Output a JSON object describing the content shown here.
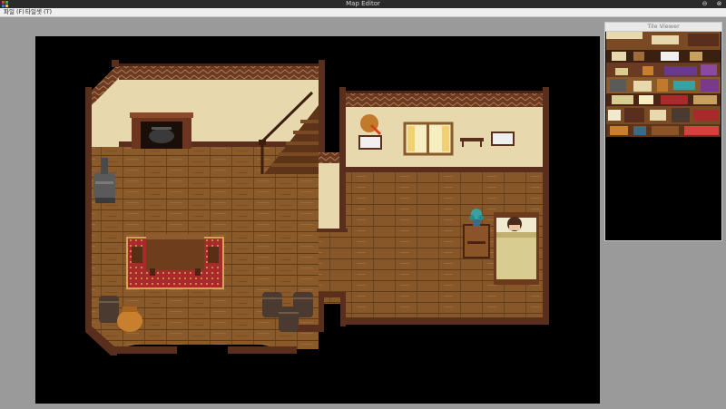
{
  "window": {
    "title": "Map Editor",
    "close_glyph": "⊗",
    "minimize_glyph": "⊖"
  },
  "menu": {
    "file": "파일 (F)",
    "tileset": "타일셋 (T)"
  },
  "tile_viewer": {
    "title": "Tile Viewer"
  },
  "colors": {
    "titlebar": "#2b2b2b",
    "menubar": "#efefef",
    "workspace": "#9a9a9a",
    "map_background": "#000000",
    "floor": "#8a5a2b",
    "wall": "#e8d8ae",
    "wall_trim": "#5a2e1c"
  },
  "map_objects": [
    "fireplace-icon",
    "staircase-icon",
    "stove-icon",
    "table-icon",
    "rug-icon",
    "barrel-icon",
    "sack-icon",
    "bed-icon",
    "nightstand-icon",
    "plant-icon",
    "window-icon",
    "guitar-icon",
    "picture-frame-icon",
    "shelf-icon"
  ]
}
